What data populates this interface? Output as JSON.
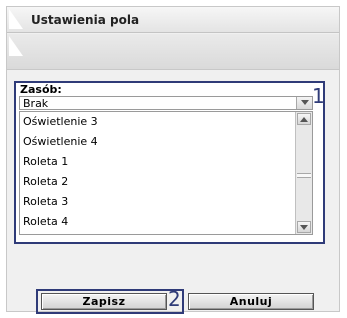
{
  "dialog": {
    "title": "Ustawienia pola"
  },
  "form": {
    "resource_label": "Zasób:",
    "selected_value": "Brak",
    "options": [
      "Oświetlenie 3",
      "Oświetlenie 4",
      "Roleta 1",
      "Roleta 2",
      "Roleta 3",
      "Roleta 4"
    ]
  },
  "actions": {
    "save_label": "Zapisz",
    "cancel_label": "Anuluj"
  },
  "markers": {
    "region_1": "1",
    "region_2": "2"
  },
  "colors": {
    "marker": "#2f3b78"
  }
}
